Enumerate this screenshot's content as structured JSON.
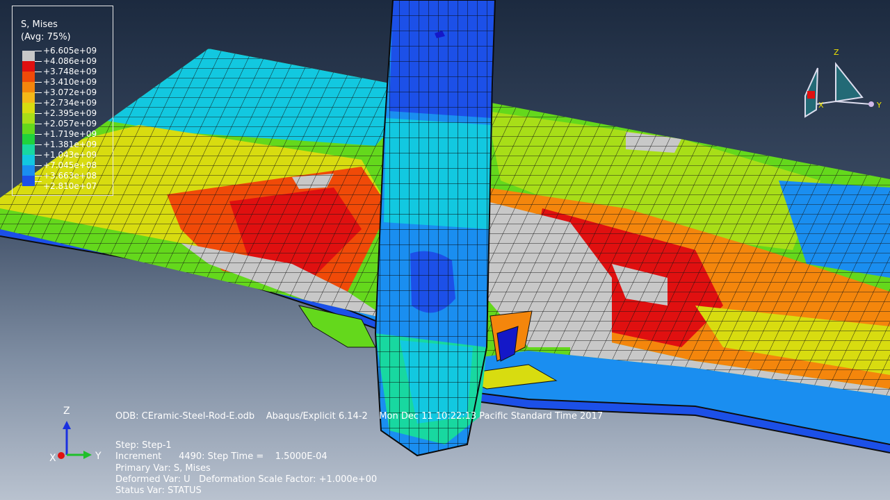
{
  "legend": {
    "title": "S, Mises",
    "subtitle": "(Avg: 75%)",
    "entries": [
      {
        "value": "+6.605e+09",
        "color": "#c8c8c8"
      },
      {
        "value": "+4.086e+09",
        "color": "#e01010"
      },
      {
        "value": "+3.748e+09",
        "color": "#f04a08"
      },
      {
        "value": "+3.410e+09",
        "color": "#f4860c"
      },
      {
        "value": "+3.072e+09",
        "color": "#f4b818"
      },
      {
        "value": "+2.734e+09",
        "color": "#d8dc10"
      },
      {
        "value": "+2.395e+09",
        "color": "#a8de18"
      },
      {
        "value": "+2.057e+09",
        "color": "#64d81c"
      },
      {
        "value": "+1.719e+09",
        "color": "#20d23c"
      },
      {
        "value": "+1.381e+09",
        "color": "#18d8a0"
      },
      {
        "value": "+1.043e+09",
        "color": "#12c8e0"
      },
      {
        "value": "+7.045e+08",
        "color": "#1a8ef0"
      },
      {
        "value": "+3.663e+08",
        "color": "#1c50e8"
      },
      {
        "value": "+2.810e+07",
        "color": "#1418c8"
      }
    ]
  },
  "info": {
    "odb_line": "ODB: CEramic-Steel-Rod-E.odb    Abaqus/Explicit 6.14-2    Mon Dec 11 10:22:13 Pacific Standard Time 2017",
    "step": "Step: Step-1",
    "increment": "Increment      4490: Step Time =    1.5000E-04",
    "primary_var": "Primary Var: S, Mises",
    "deformed_var": "Deformed Var: U   Deformation Scale Factor: +1.000e+00",
    "status_var": "Status Var: STATUS"
  },
  "triad": {
    "x": "X",
    "y": "Y",
    "z": "Z"
  },
  "view_cube": {
    "x": "X",
    "y": "Y",
    "z": "Z"
  }
}
